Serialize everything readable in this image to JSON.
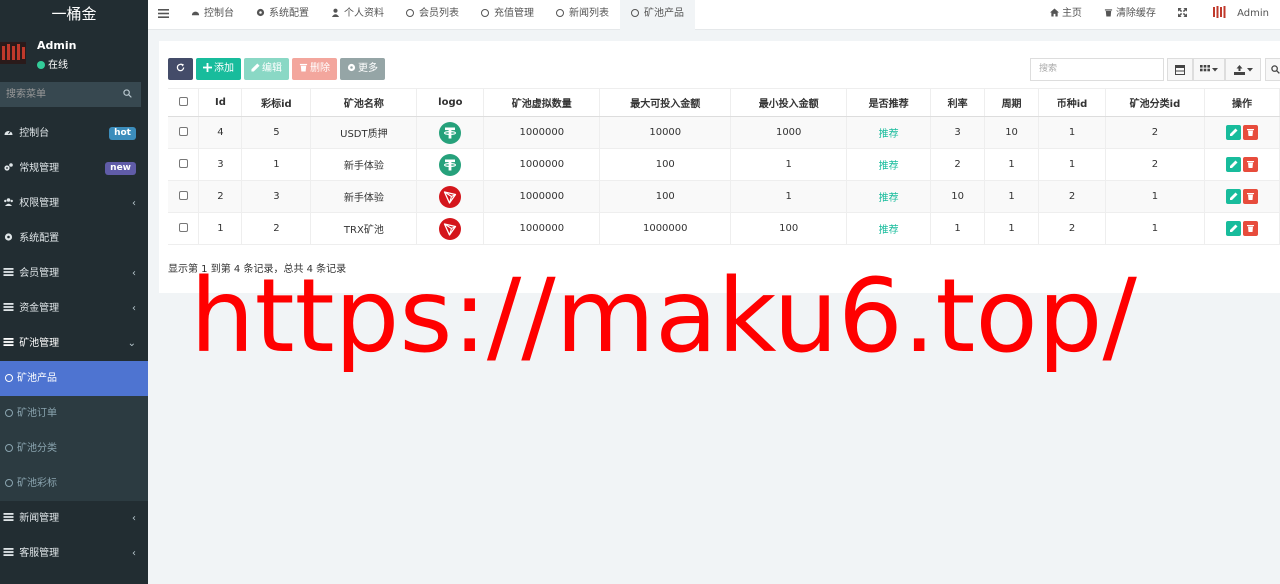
{
  "brand": {
    "title": "一桶金"
  },
  "user": {
    "name": "Admin",
    "status": "在线"
  },
  "sidebar_search": {
    "placeholder": "搜索菜单"
  },
  "menu": [
    {
      "label": "控制台",
      "icon": "dashboard-icon",
      "badge": "hot"
    },
    {
      "label": "常规管理",
      "icon": "cogs-icon",
      "badge": "new"
    },
    {
      "label": "权限管理",
      "icon": "group-icon",
      "chevron": "‹"
    },
    {
      "label": "系统配置",
      "icon": "cog-icon"
    },
    {
      "label": "会员管理",
      "icon": "list-icon",
      "chevron": "‹"
    },
    {
      "label": "资金管理",
      "icon": "list-icon",
      "chevron": "‹"
    },
    {
      "label": "矿池管理",
      "icon": "list-icon",
      "chevron": "⌄",
      "open": true
    }
  ],
  "submenu": [
    {
      "label": "矿池产品",
      "active": true
    },
    {
      "label": "矿池订单"
    },
    {
      "label": "矿池分类"
    },
    {
      "label": "矿池彩标"
    }
  ],
  "menu_bottom": [
    {
      "label": "新闻管理",
      "icon": "list-icon",
      "chevron": "‹"
    },
    {
      "label": "客服管理",
      "icon": "list-icon",
      "chevron": "‹"
    }
  ],
  "tabs": [
    {
      "label": "控制台",
      "icon": "dashboard-icon"
    },
    {
      "label": "系统配置",
      "icon": "cog-icon"
    },
    {
      "label": "个人资料",
      "icon": "user-icon"
    },
    {
      "label": "会员列表",
      "icon": "circle-icon"
    },
    {
      "label": "充值管理",
      "icon": "circle-icon"
    },
    {
      "label": "新闻列表",
      "icon": "circle-icon"
    },
    {
      "label": "矿池产品",
      "icon": "circle-icon",
      "active": true
    }
  ],
  "nav_right": {
    "home": "主页",
    "clear_cache": "清除缓存",
    "admin": "Admin"
  },
  "toolbar": {
    "add": "添加",
    "edit": "编辑",
    "delete": "删除",
    "more": "更多"
  },
  "table_search": {
    "placeholder": "搜索"
  },
  "table": {
    "headers": [
      "Id",
      "彩标id",
      "矿池名称",
      "logo",
      "矿池虚拟数量",
      "最大可投入金额",
      "最小投入金额",
      "是否推荐",
      "利率",
      "周期",
      "币种id",
      "矿池分类id",
      "操作"
    ],
    "rows": [
      {
        "id": "4",
        "tag_id": "5",
        "name": "USDT质押",
        "logo": "tether",
        "virtual": "1000000",
        "max": "10000",
        "min": "1000",
        "recommend": "推荐",
        "rate": "3",
        "period": "10",
        "coin_id": "1",
        "cat_id": "2"
      },
      {
        "id": "3",
        "tag_id": "1",
        "name": "新手体验",
        "logo": "tether",
        "virtual": "1000000",
        "max": "100",
        "min": "1",
        "recommend": "推荐",
        "rate": "2",
        "period": "1",
        "coin_id": "1",
        "cat_id": "2"
      },
      {
        "id": "2",
        "tag_id": "3",
        "name": "新手体验",
        "logo": "tron",
        "virtual": "1000000",
        "max": "100",
        "min": "1",
        "recommend": "推荐",
        "rate": "10",
        "period": "1",
        "coin_id": "2",
        "cat_id": "1"
      },
      {
        "id": "1",
        "tag_id": "2",
        "name": "TRX矿池",
        "logo": "tron",
        "virtual": "1000000",
        "max": "1000000",
        "min": "100",
        "recommend": "推荐",
        "rate": "1",
        "period": "1",
        "coin_id": "2",
        "cat_id": "1"
      }
    ]
  },
  "pagination": {
    "info": "显示第 1 到第 4 条记录，总共 4 条记录"
  },
  "watermark": {
    "text": "https://maku6.top/"
  },
  "colors": {
    "sidebar": "#222d32",
    "active_sub": "#4e74d1",
    "primary": "#18bc9c",
    "danger": "#e74c3c",
    "watermark": "#ff0000"
  }
}
